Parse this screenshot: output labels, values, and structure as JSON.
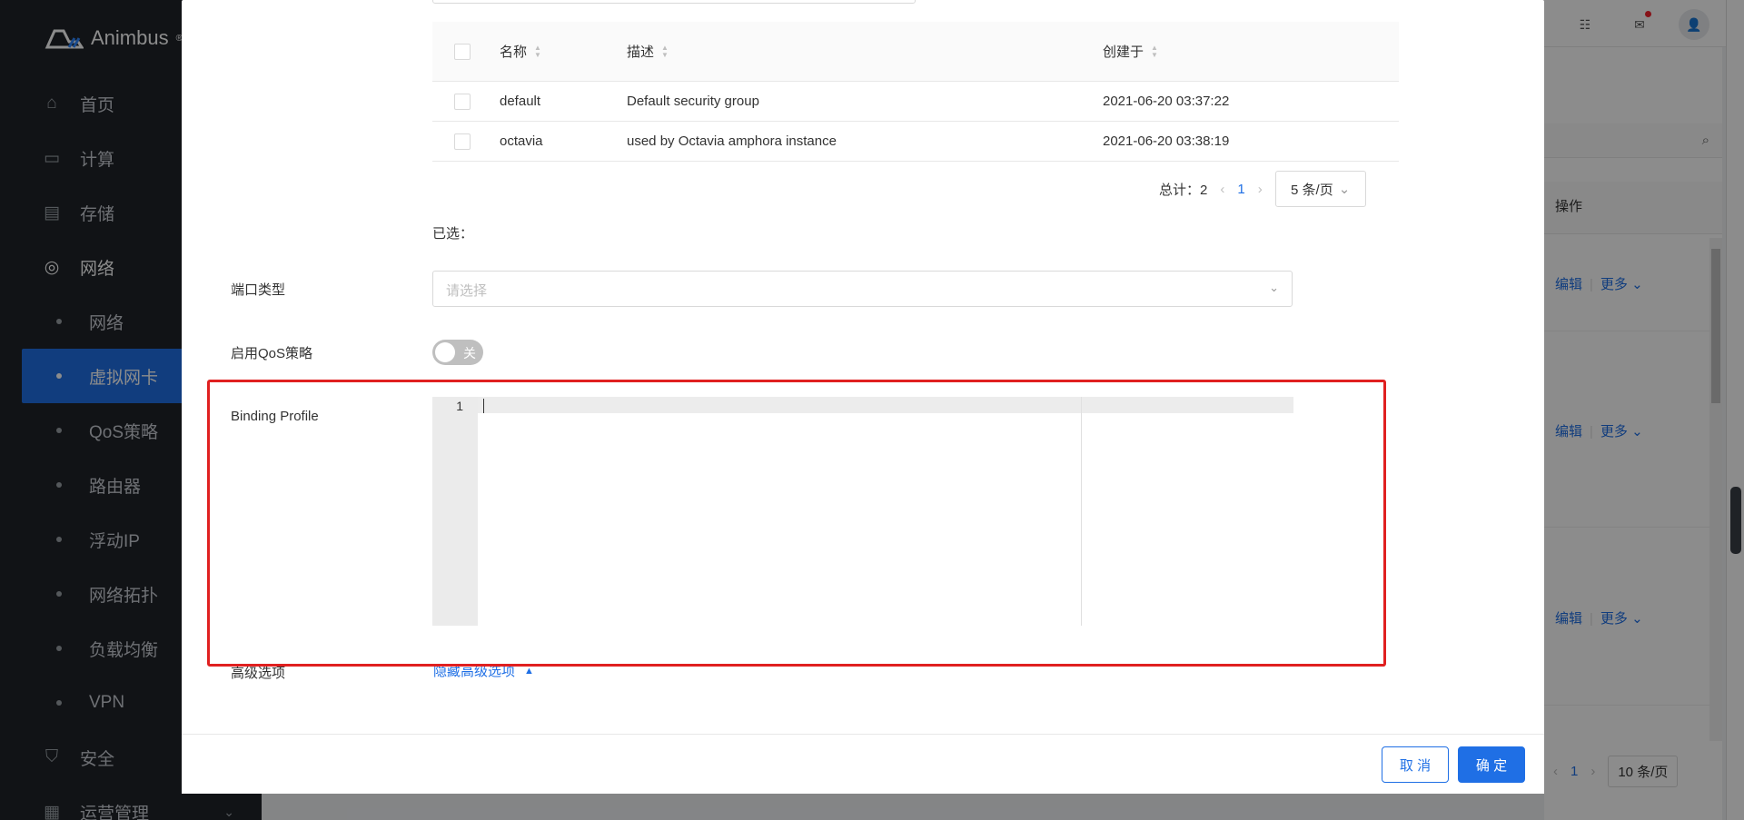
{
  "app": {
    "name": "Animbus",
    "mark": "®"
  },
  "sidebar": {
    "items": [
      {
        "label": "首页",
        "icon": "home-icon"
      },
      {
        "label": "计算",
        "icon": "monitor-icon"
      },
      {
        "label": "存储",
        "icon": "storage-icon"
      },
      {
        "label": "网络",
        "icon": "globe-icon"
      }
    ],
    "sub_items": [
      {
        "label": "网络"
      },
      {
        "label": "虚拟网卡"
      },
      {
        "label": "QoS策略"
      },
      {
        "label": "路由器"
      },
      {
        "label": "浮动IP"
      },
      {
        "label": "网络拓扑"
      },
      {
        "label": "负载均衡"
      },
      {
        "label": "VPN"
      }
    ],
    "bottom_items": [
      {
        "label": "安全",
        "icon": "shield-icon"
      },
      {
        "label": "运营管理",
        "icon": "calendar-icon"
      }
    ],
    "selected": "虚拟网卡"
  },
  "background": {
    "column_header": "操作",
    "rows": [
      {
        "edit": "编辑",
        "more": "更多"
      },
      {
        "edit": "编辑",
        "more": "更多"
      },
      {
        "edit": "编辑",
        "more": "更多"
      }
    ],
    "pagination": {
      "page": "1",
      "page_size": "10 条/页"
    }
  },
  "modal": {
    "table": {
      "columns": [
        "名称",
        "描述",
        "创建于"
      ],
      "rows": [
        {
          "name": "default",
          "description": "Default security group",
          "created": "2021-06-20 03:37:22"
        },
        {
          "name": "octavia",
          "description": "used by Octavia amphora instance",
          "created": "2021-06-20 03:38:19"
        }
      ],
      "pagination": {
        "total_label": "总计：2",
        "page": "1",
        "page_size": "5 条/页"
      }
    },
    "selected_label": "已选：",
    "fields": {
      "port_type": {
        "label": "端口类型",
        "placeholder": "请选择"
      },
      "qos": {
        "label": "启用QoS策略",
        "switch_text": "关",
        "checked": false
      },
      "binding_profile": {
        "label": "Binding Profile",
        "line_number": "1"
      },
      "advanced": {
        "label": "高级选项",
        "link": "隐藏高级选项"
      }
    },
    "footer": {
      "cancel": "取 消",
      "ok": "确 定"
    }
  },
  "colors": {
    "primary": "#1f6fe5",
    "highlight": "#e02020",
    "sidebar_bg": "#1f2329"
  }
}
